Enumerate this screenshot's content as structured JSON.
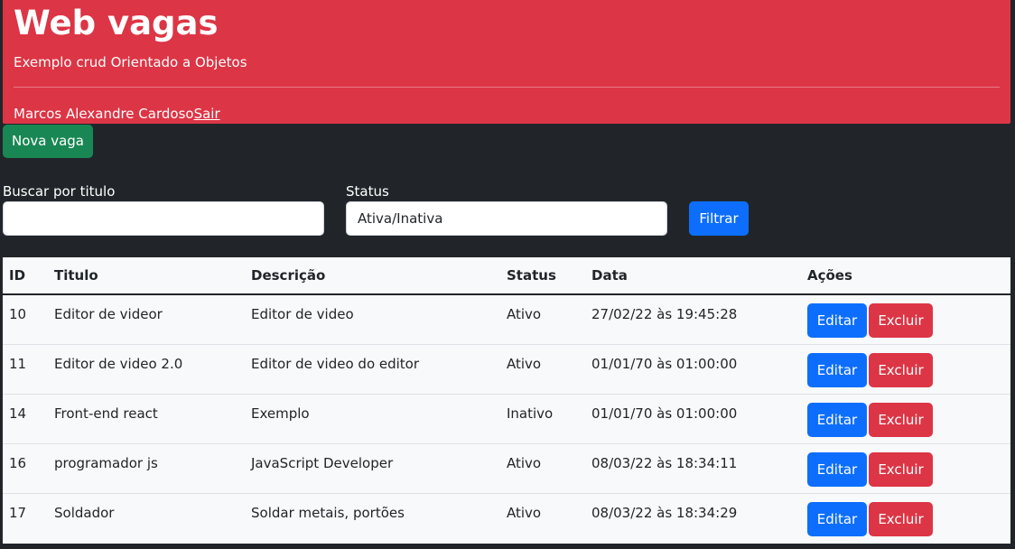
{
  "header": {
    "title": "Web vagas",
    "subtitle": "Exemplo crud Orientado a Objetos",
    "user_name": "Marcos Alexandre Cardoso",
    "logout_label": "Sair"
  },
  "toolbar": {
    "new_label": "Nova vaga"
  },
  "filters": {
    "search_label": "Buscar por titulo",
    "search_value": "",
    "status_label": "Status",
    "status_value": "Ativa/Inativa",
    "filter_label": "Filtrar"
  },
  "table": {
    "columns": [
      "ID",
      "Titulo",
      "Descrição",
      "Status",
      "Data",
      "Ações"
    ],
    "edit_label": "Editar",
    "delete_label": "Excluir",
    "rows": [
      {
        "id": "10",
        "titulo": "Editor de videor",
        "descricao": "Editor de video",
        "status": "Ativo",
        "data": "27/02/22 às 19:45:28"
      },
      {
        "id": "11",
        "titulo": "Editor de video 2.0",
        "descricao": "Editor de video do editor",
        "status": "Ativo",
        "data": "01/01/70 às 01:00:00"
      },
      {
        "id": "14",
        "titulo": "Front-end react",
        "descricao": "Exemplo",
        "status": "Inativo",
        "data": "01/01/70 às 01:00:00"
      },
      {
        "id": "16",
        "titulo": "programador js",
        "descricao": "JavaScript Developer",
        "status": "Ativo",
        "data": "08/03/22 às 18:34:11"
      },
      {
        "id": "17",
        "titulo": "Soldador",
        "descricao": "Soldar metais, portões",
        "status": "Ativo",
        "data": "08/03/22 às 18:34:29"
      }
    ]
  },
  "colors": {
    "header_bg": "#dc3545",
    "page_bg": "#212529",
    "success": "#198754",
    "primary": "#0d6efd",
    "danger": "#dc3545",
    "table_bg": "#f8f9fa"
  }
}
